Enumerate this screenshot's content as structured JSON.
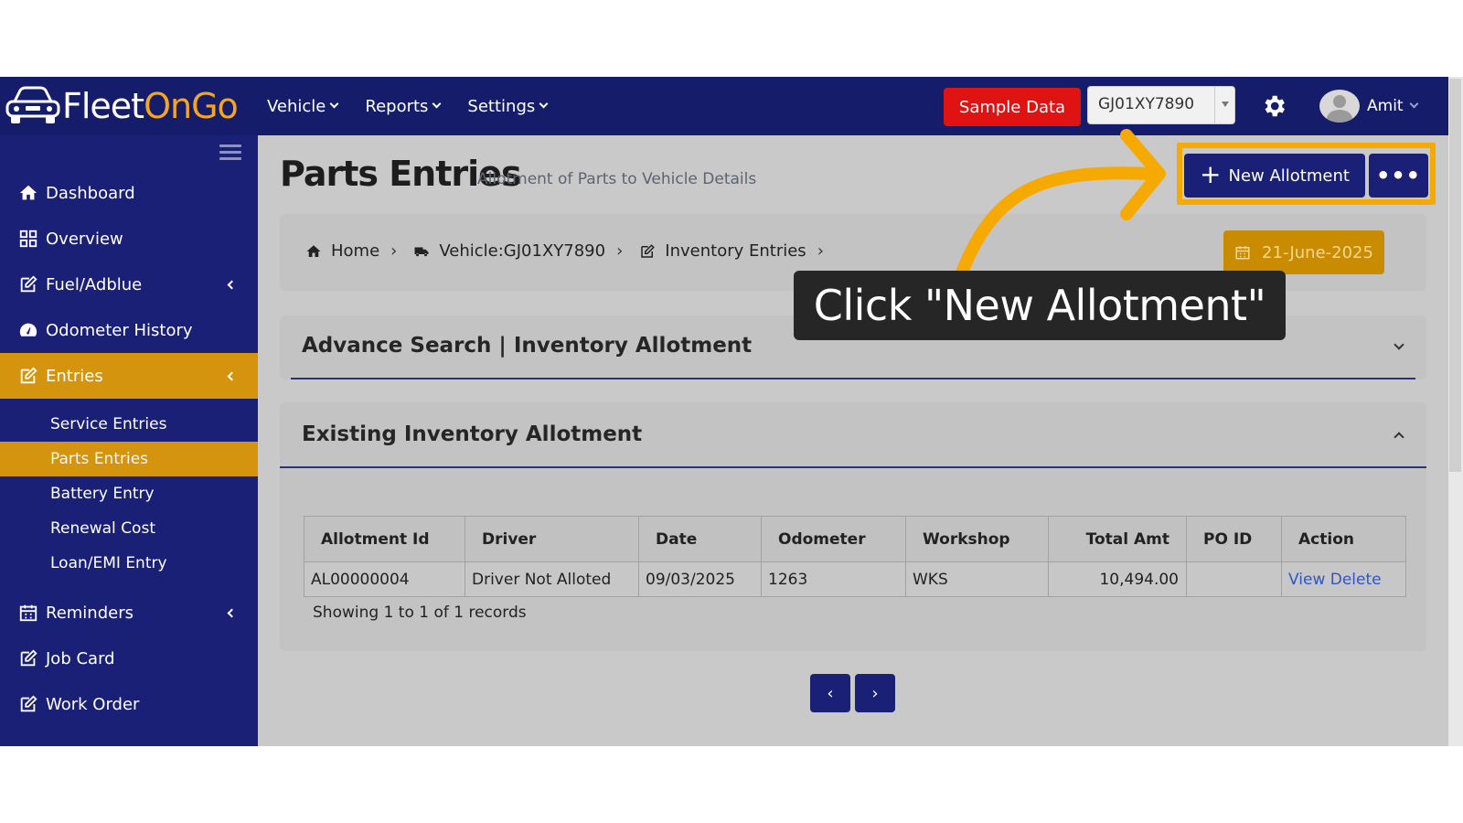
{
  "brand": {
    "name_part1": "Fleet",
    "name_part2": "OnGo",
    "primary_color": "#1b2077",
    "accent_color": "#d4940d"
  },
  "topnav": {
    "items": [
      "Vehicle",
      "Reports",
      "Settings"
    ],
    "sample_data_label": "Sample Data",
    "vehicle_selected": "GJ01XY7890",
    "user_name": "Amit"
  },
  "sidebar": {
    "items": {
      "dashboard": "Dashboard",
      "overview": "Overview",
      "fuel": "Fuel/Adblue",
      "odometer": "Odometer History",
      "entries": "Entries",
      "reminders": "Reminders",
      "job_card": "Job Card",
      "work_order": "Work Order"
    },
    "sub_items": {
      "service": "Service Entries",
      "parts": "Parts Entries",
      "battery": "Battery Entry",
      "renewal": "Renewal Cost",
      "loan": "Loan/EMI Entry"
    },
    "active_item": "Entries",
    "active_sub_item": "Parts Entries"
  },
  "page": {
    "title": "Parts Entries",
    "subtitle": "Allotment of Parts to Vehicle Details",
    "new_button_label": "New Allotment",
    "more_button_label": "•••"
  },
  "breadcrumb": {
    "home": "Home",
    "vehicle": "Vehicle:GJ01XY7890",
    "inventory": "Inventory Entries",
    "date": "21-June-2025"
  },
  "panels": {
    "search_title": "Advance Search | Inventory Allotment",
    "existing_title": "Existing Inventory Allotment"
  },
  "table": {
    "headers": [
      "Allotment Id",
      "Driver",
      "Date",
      "Odometer",
      "Workshop",
      "Total Amt",
      "PO ID",
      "Action"
    ],
    "rows": [
      {
        "allotment_id": "AL00000004",
        "driver": "Driver Not Alloted",
        "date": "09/03/2025",
        "odometer": "1263",
        "workshop": "WKS",
        "total_amt": "10,494.00",
        "po_id": "",
        "view": "View",
        "delete": "Delete"
      }
    ],
    "records_text": "Showing 1 to 1 of 1 records"
  },
  "pagination": {
    "prev": "‹",
    "next": "›"
  },
  "callout": {
    "text": "Click \"New Allotment\"",
    "highlight_color": "#f6a900"
  }
}
